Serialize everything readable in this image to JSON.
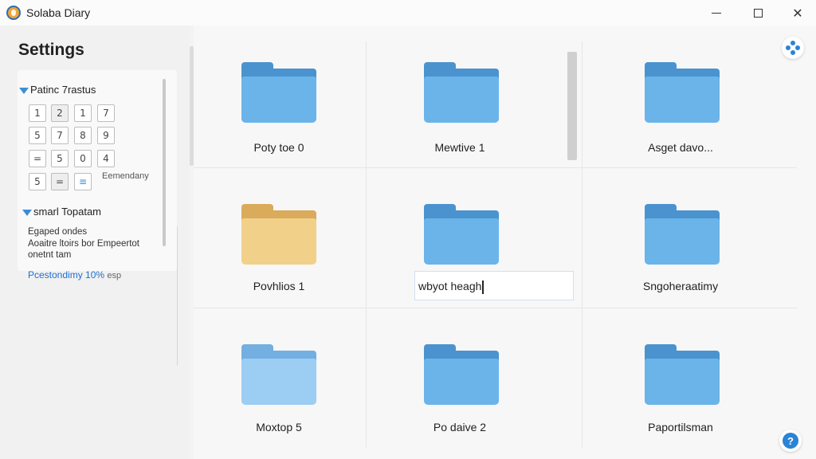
{
  "window": {
    "title": "Solaba Diary",
    "minimize_icon": "minimize-icon",
    "maximize_icon": "maximize-icon",
    "close_glyph": "✕"
  },
  "sidebar": {
    "title": "Settings",
    "section1": "Patinc 7rastus",
    "keys": [
      "1",
      "2",
      "1",
      "7",
      "5",
      "7",
      "8",
      "9",
      "=",
      "5",
      "0",
      "4",
      "5",
      "=",
      "≡"
    ],
    "key_legend": "Eemendany",
    "section2": "smarl Topatam",
    "desc1": "Egaped ondes",
    "desc2": "Aoaitre ltoirs bor Empeertot",
    "desc3": "onetnt tam",
    "link": "Pcestondimy 10%",
    "link_suffix": "esp"
  },
  "folders": [
    {
      "label": "Poty toe 0",
      "color": "blue"
    },
    {
      "label": "Mewtive 1",
      "color": "blue"
    },
    {
      "label": "Asget davo...",
      "color": "blue"
    },
    {
      "label": "Povhlios 1",
      "color": "yellow"
    },
    {
      "label": "wbyot heagh",
      "color": "blue",
      "editing": true
    },
    {
      "label": "Sngoheraatimy",
      "color": "blue"
    },
    {
      "label": "Moxtop 5",
      "color": "light"
    },
    {
      "label": "Po daive 2",
      "color": "blue"
    },
    {
      "label": "Paportilsman",
      "color": "blue"
    }
  ],
  "colors": {
    "accent": "#2b83d4",
    "folder_blue": "#6ab4ea",
    "folder_yellow": "#f1d08a",
    "link": "#1f6fd0"
  },
  "icons": {
    "fab_top": "apps-icon",
    "fab_bottom": "help-icon"
  }
}
